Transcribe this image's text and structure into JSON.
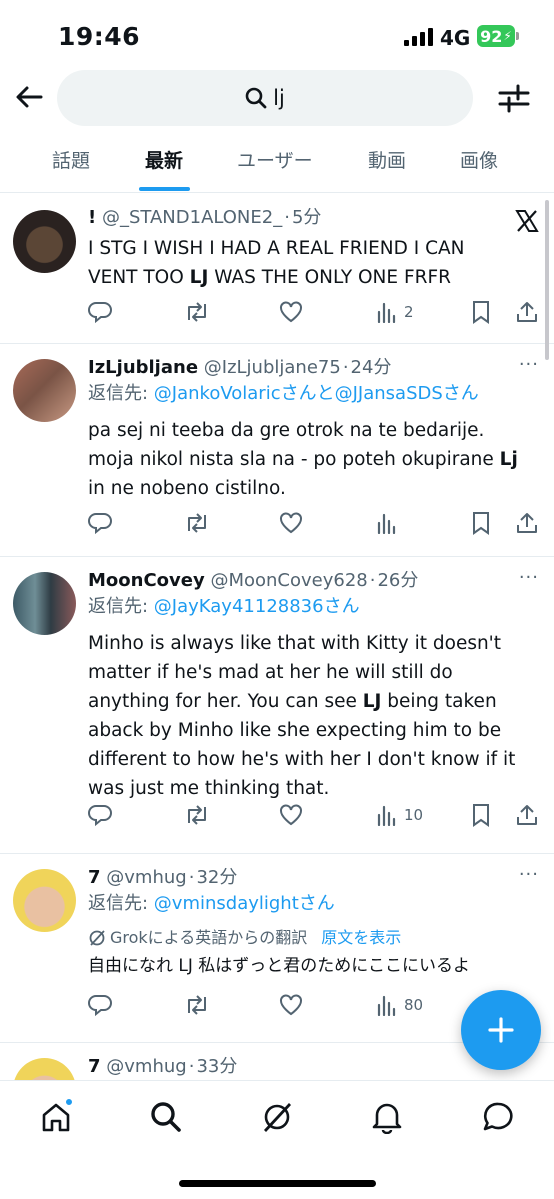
{
  "status_bar": {
    "time": "19:46",
    "network": "4G",
    "battery": "92"
  },
  "search": {
    "query": "lj"
  },
  "tabs": [
    {
      "label": "話題"
    },
    {
      "label": "最新"
    },
    {
      "label": "ユーザー"
    },
    {
      "label": "動画"
    },
    {
      "label": "画像"
    }
  ],
  "active_tab": "最新",
  "tweets": [
    {
      "name": "!",
      "handle": "@_STAND1ALONE2_",
      "time": "5分",
      "body_lines": [
        "I STG I WISH I HAD A REAL FRIEND I CAN",
        "VENT TOO ",
        "LJ",
        " WAS THE ONLY ONE FRFR"
      ],
      "views": "2"
    },
    {
      "name": "IzLjubljane",
      "handle": "@IzLjubljane75",
      "time": "24分",
      "reply_prefix": "返信先: ",
      "reply_to_1": "@JankoVolaric",
      "reply_joiner": "さんと",
      "reply_to_2": "@JJansaSDS",
      "reply_suffix": "さん",
      "body_1": "pa sej ni teeba da gre otrok na te bedarije.",
      "body_2a": "moja nikol nista sla na - po poteh okupirane ",
      "body_2b": "Lj",
      "body_3": "in ne nobeno cistilno.",
      "views": ""
    },
    {
      "name": "MoonCovey",
      "handle": "@MoonCovey628",
      "time": "26分",
      "reply_prefix": "返信先: ",
      "reply_to_1": "@JayKay41128836",
      "reply_suffix": "さん",
      "body_1": "Minho is always like that with Kitty it doesn't matter if he's mad at her he will still do anything for her.  You can see ",
      "body_bold": "LJ",
      "body_2": " being taken aback by Minho like she expecting him to be different to how he's with her I don't know if it was just me thinking that.",
      "views": "10"
    },
    {
      "name": "7",
      "handle": "@vmhug",
      "time": "32分",
      "reply_prefix": "返信先: ",
      "reply_to_1": "@vminsdaylight",
      "reply_suffix": "さん",
      "translation_note": "Grokによる英語からの翻訳",
      "show_original": "原文を表示",
      "body": "自由になれ LJ 私はずっと君のためにここにいるよ",
      "views": "80"
    },
    {
      "name": "7",
      "handle": "@vmhug",
      "time": "33分"
    }
  ],
  "meta_separator": "·",
  "more_label": "···",
  "fab_label": "+",
  "colors": {
    "accent": "#1d9bf0",
    "text": "#0f1419",
    "secondary": "#536471",
    "battery": "#34c759"
  },
  "bottom_nav": [
    {
      "icon": "home-icon"
    },
    {
      "icon": "search-icon"
    },
    {
      "icon": "grok-icon"
    },
    {
      "icon": "notifications-icon"
    },
    {
      "icon": "messages-icon"
    }
  ]
}
